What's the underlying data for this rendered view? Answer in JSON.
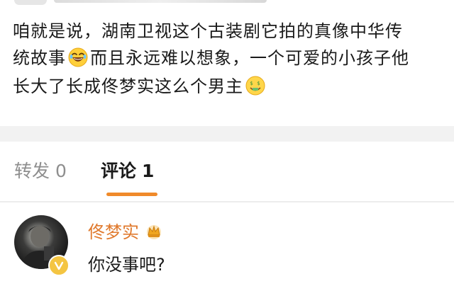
{
  "post": {
    "line1": "咱就是说，湖南卫视这个古装剧它拍的真像中华传",
    "line2_before": "统故事",
    "line2_after": "而且永远难以想象，一个可爱的小孩子他",
    "line3": "长大了长成佟梦实这么个男主",
    "emoji_laugh": "laughing-emoji",
    "emoji_money": "money-mouth-emoji"
  },
  "tabs": {
    "forward_label": "转发",
    "forward_count": "0",
    "comments_label": "评论",
    "comments_count": "1",
    "indicator_color": "#f08a2a"
  },
  "comment": {
    "username": "佟梦实",
    "text": "你没事吧?",
    "username_color": "#e07a2e",
    "badge_icon": "crown-icon",
    "verify_icon": "verified-v-icon"
  }
}
